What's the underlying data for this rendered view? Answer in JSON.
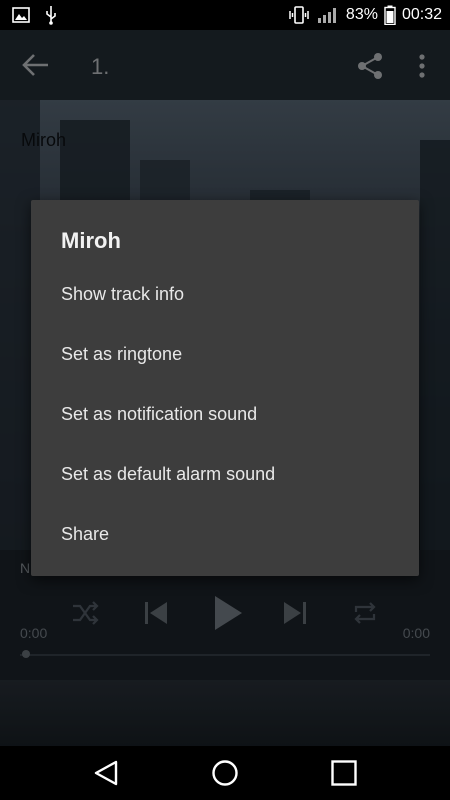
{
  "status_bar": {
    "battery_percent": "83%",
    "time": "00:32",
    "icons": [
      "image-icon",
      "usb-icon",
      "vibrate-icon",
      "signal-icon",
      "battery-icon"
    ]
  },
  "toolbar": {
    "title": "1.",
    "back_icon": "arrow-back-icon",
    "share_icon": "share-icon",
    "more_icon": "more-vert-icon"
  },
  "artwork": {
    "artist": "Miroh"
  },
  "player": {
    "subtitle": "N",
    "time_elapsed": "0:00",
    "time_total": "0:00",
    "progress": 0
  },
  "dialog": {
    "title": "Miroh",
    "items": [
      {
        "label": "Show track info"
      },
      {
        "label": "Set as ringtone"
      },
      {
        "label": "Set as notification sound"
      },
      {
        "label": "Set as default alarm sound"
      },
      {
        "label": "Share"
      }
    ]
  },
  "colors": {
    "toolbar": "#263038",
    "dialog_bg": "#3d3d3d",
    "dialog_text": "#e8e8e8"
  }
}
